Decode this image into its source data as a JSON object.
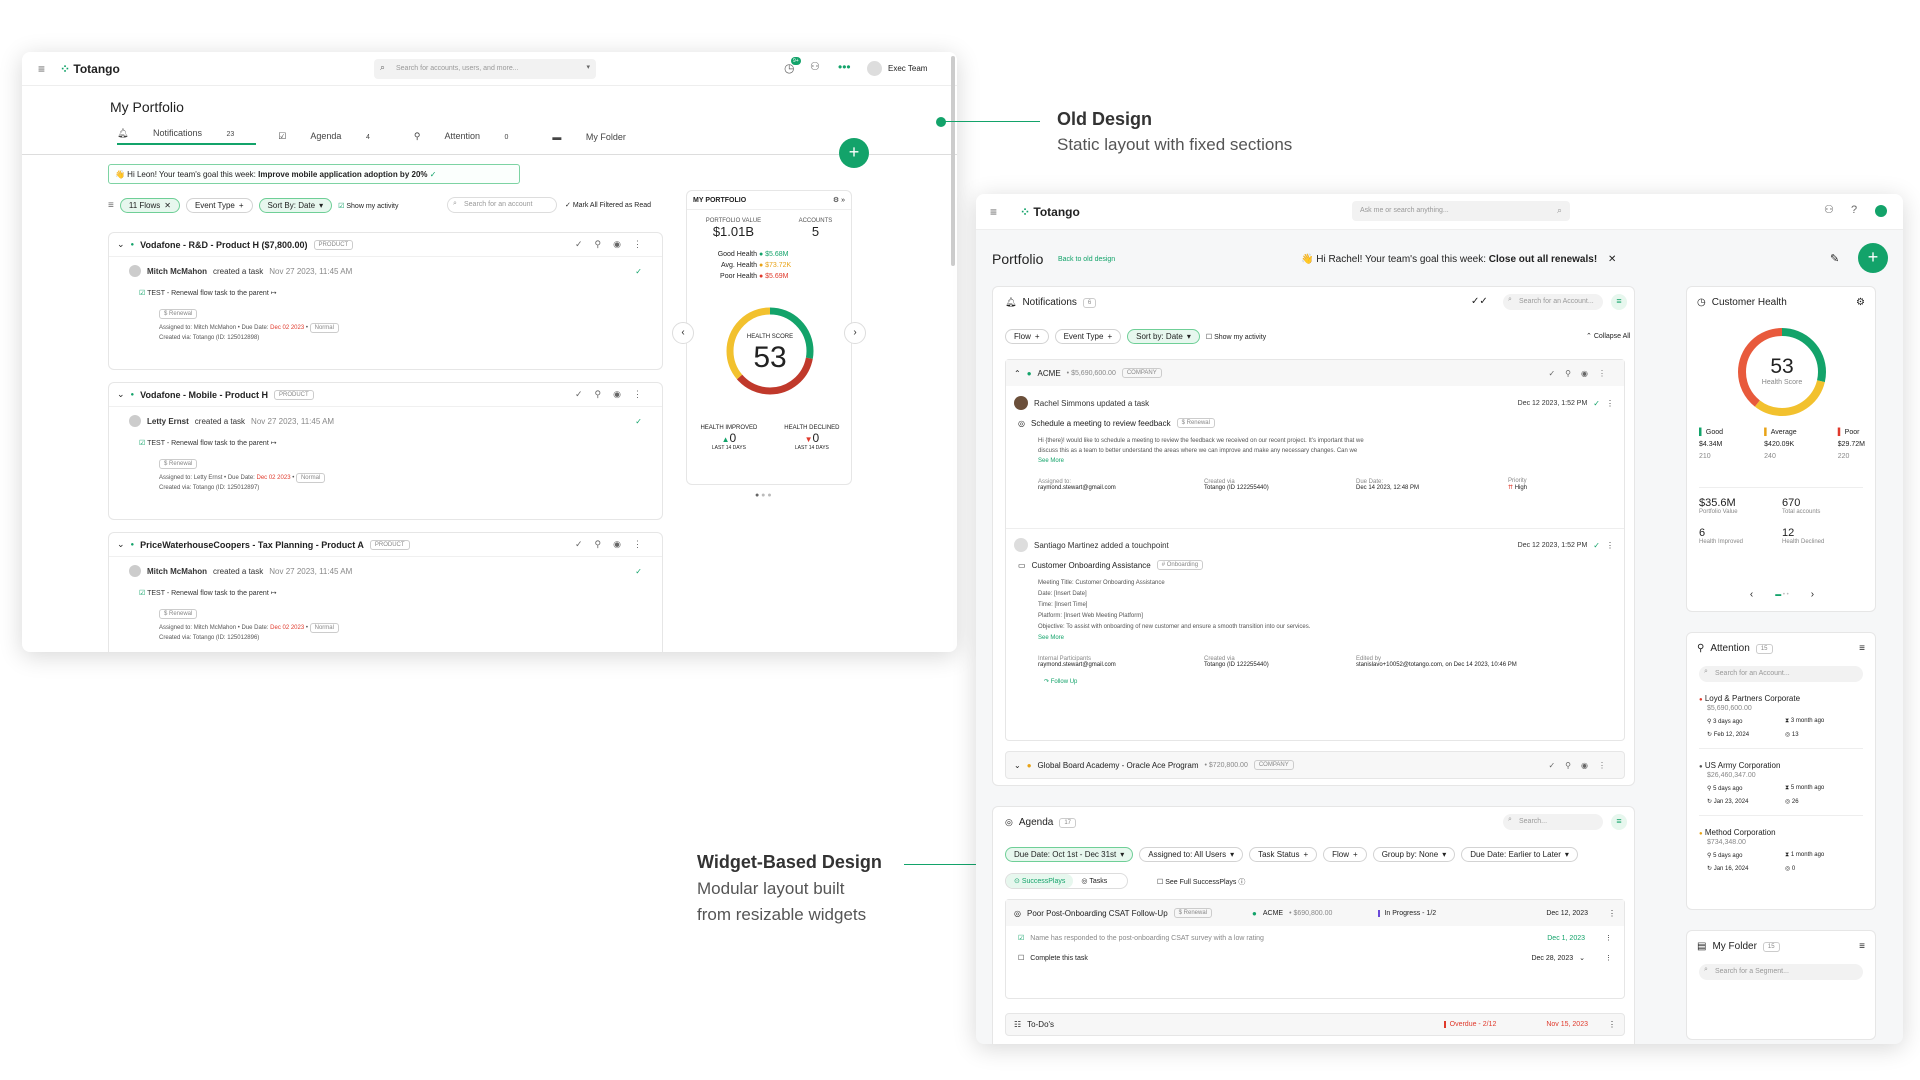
{
  "brand": "Totango",
  "old": {
    "search_placeholder": "Search for accounts, users, and more...",
    "user": "Exec Team",
    "badge": "9+",
    "page_title": "My Portfolio",
    "tabs": [
      {
        "label": "Notifications",
        "count": "23"
      },
      {
        "label": "Agenda",
        "count": "4"
      },
      {
        "label": "Attention",
        "count": "0"
      },
      {
        "label": "My Folder",
        "count": ""
      }
    ],
    "goal_prefix": "👋 Hi Leon! Your team's goal this week:",
    "goal_text": "Improve mobile application adoption by 20%",
    "filters": [
      "11 Flows",
      "Event Type",
      "Sort By: Date"
    ],
    "show_activity": "Show my activity",
    "search_account": "Search for an account",
    "mark_all": "Mark All Filtered as Read",
    "notifications": [
      {
        "title": "Vodafone - R&D - Product H ($7,800.00)",
        "tag": "PRODUCT",
        "user": "Mitch McMahon",
        "action": "created a task",
        "time": "Nov 27 2023, 11:45 AM",
        "task": "TEST - Renewal flow task to the parent ↦",
        "chip": "$ Renewal",
        "assigned": "Assigned to: Mitch McMahon",
        "due_label": "Due Date:",
        "due": "Dec 02 2023",
        "priority": "Normal",
        "created": "Created via: Totango (ID: 125012898)"
      },
      {
        "title": "Vodafone - Mobile - Product H",
        "tag": "PRODUCT",
        "user": "Letty Ernst",
        "action": "created a task",
        "time": "Nov 27 2023, 11:45 AM",
        "task": "TEST - Renewal flow task to the parent ↦",
        "chip": "$ Renewal",
        "assigned": "Assigned to: Letty Ernst",
        "due_label": "Due Date:",
        "due": "Dec 02 2023",
        "priority": "Normal",
        "created": "Created via: Totango (ID: 125012897)"
      },
      {
        "title": "PriceWaterhouseCoopers - Tax Planning - Product A",
        "tag": "PRODUCT",
        "user": "Mitch McMahon",
        "action": "created a task",
        "time": "Nov 27 2023, 11:45 AM",
        "task": "TEST - Renewal flow task to the parent ↦",
        "chip": "$ Renewal",
        "assigned": "Assigned to: Mitch McMahon",
        "due_label": "Due Date:",
        "due": "Dec 02 2023",
        "priority": "Normal",
        "created": "Created via: Totango (ID: 125012896)"
      }
    ],
    "portfolio": {
      "title": "MY PORTFOLIO",
      "value_label": "PORTFOLIO VALUE",
      "value": "$1.01B",
      "accounts_label": "ACCOUNTS",
      "accounts": "5",
      "good_label": "Good Health",
      "good": "$5.68M",
      "avg_label": "Avg. Health",
      "avg": "$73.72K",
      "poor_label": "Poor Health",
      "poor": "$5.69M",
      "score_label": "HEALTH SCORE",
      "score": "53",
      "improved_label": "HEALTH IMPROVED",
      "improved": "0",
      "declined_label": "HEALTH DECLINED",
      "declined": "0",
      "period": "LAST 14 DAYS"
    }
  },
  "callouts": {
    "old_title": "Old Design",
    "old_sub": "Static layout with fixed sections",
    "new_title": "Widget-Based Design",
    "new_sub1": "Modular layout built",
    "new_sub2": "from resizable widgets"
  },
  "new": {
    "search_placeholder": "Ask me or search anything...",
    "page_title": "Portfolio",
    "back_link": "Back to old design",
    "goal_prefix": "👋 Hi Rachel! Your team's goal this week:",
    "goal_text": "Close out all renewals!",
    "notifications": {
      "title": "Notifications",
      "count": "6",
      "search": "Search for an Account...",
      "filters": [
        "Flow",
        "Event Type",
        "Sort by: Date"
      ],
      "show_activity": "Show my activity",
      "collapse": "Collapse All",
      "group1": {
        "name": "ACME",
        "amount": "• $5,690,600.00",
        "tag": "COMPANY"
      },
      "item1": {
        "user": "Rachel Simmons updated a task",
        "time": "Dec 12 2023, 1:52 PM",
        "task": "Schedule a meeting to review feedback",
        "chip": "$ Renewal",
        "body1": "Hi {there}! would like to schedule a meeting to review the feedback we received on our recent project. It's important that we",
        "body2": "discuss this as a team to better understand the areas where we can improve and make any necessary changes. Can we",
        "see_more": "See More",
        "c1l": "Assigned to:",
        "c1v": "raymond.stewart@gmail.com",
        "c2l": "Created via",
        "c2v": "Totango (ID 122255440)",
        "c3l": "Due Date:",
        "c3v": "Dec 14 2023, 12:48 PM",
        "c4l": "Priority",
        "c4v": "High"
      },
      "item2": {
        "user": "Santiago Martinez added a touchpoint",
        "time": "Dec 12 2023, 1:52 PM",
        "task": "Customer Onboarding Assistance",
        "chip": "# Onboarding",
        "lines": [
          "Meeting Title: Customer Onboarding Assistance",
          "Date: [Insert Date]",
          "Time: [Insert Time]",
          "Platform: [Insert Web Meeting Platform]",
          "Objective: To assist with onboarding of new customer and ensure a smooth transition into our services."
        ],
        "see_more": "See More",
        "c1l": "Internal Participants",
        "c1v": "raymond.stewart@gmail.com",
        "c2l": "Created via",
        "c2v": "Totango (ID 122255440)",
        "c3l": "Edited by",
        "c3v": "stanislavo+10052@totango.com, on Dec 14 2023, 10:46 PM",
        "follow": "Follow Up"
      },
      "group2": {
        "name": "Global Board Academy - Oracle Ace Program",
        "amount": "• $720,800.00",
        "tag": "COMPANY"
      }
    },
    "agenda": {
      "title": "Agenda",
      "count": "17",
      "search": "Search...",
      "filters": [
        "Due Date: Oct 1st - Dec 31st",
        "Assigned to: All Users",
        "Task Status",
        "Flow",
        "Group by: None",
        "Due Date: Earlier to Later"
      ],
      "seg1": "SuccessPlays",
      "seg2": "Tasks",
      "full": "See Full SuccessPlays",
      "play": {
        "title": "Poor Post-Onboarding CSAT Follow-Up",
        "chip": "$ Renewal",
        "acct": "ACME",
        "amount": "• $690,800.00",
        "status": "In Progress - 1/2",
        "date": "Dec 12, 2023"
      },
      "t1": {
        "text": "Name has responded to the post-onboarding CSAT survey with a low rating",
        "date": "Dec 1, 2023"
      },
      "t2": {
        "text": "Complete this task",
        "date": "Dec 28, 2023"
      },
      "todo": {
        "title": "To-Do's",
        "status": "Overdue - 2/12",
        "date": "Nov 15, 2023"
      }
    },
    "health": {
      "title": "Customer Health",
      "score": "53",
      "score_label": "Health Score",
      "good": "Good",
      "good_v": "$4.34M",
      "good_n": "210",
      "avg": "Average",
      "avg_v": "$420.09K",
      "avg_n": "240",
      "poor": "Poor",
      "poor_v": "$29.72M",
      "poor_n": "220",
      "pv": "$35.6M",
      "pv_l": "Portfolio Value",
      "ta": "670",
      "ta_l": "Total accounts",
      "hi": "6",
      "hi_l": "Health Improved",
      "hd": "12",
      "hd_l": "Health Declined"
    },
    "attention": {
      "title": "Attention",
      "count": "15",
      "search": "Search for an Account...",
      "items": [
        {
          "name": "Loyd & Partners Corporate",
          "amount": "$5,690,600.00",
          "a": "3 days ago",
          "b": "3 month ago",
          "c": "Feb 12, 2024",
          "d": "13",
          "color": "#e03a2c"
        },
        {
          "name": "US Army Corporation",
          "amount": "$26,460,347.00",
          "a": "5 days ago",
          "b": "5 month ago",
          "c": "Jan 23, 2024",
          "d": "26",
          "color": "#555555"
        },
        {
          "name": "Method Corporation",
          "amount": "$734,348.00",
          "a": "5 days ago",
          "b": "1 month ago",
          "c": "Jan 16, 2024",
          "d": "0",
          "color": "#e8a317"
        }
      ]
    },
    "folder": {
      "title": "My Folder",
      "count": "15",
      "search": "Search for a Segment..."
    }
  }
}
